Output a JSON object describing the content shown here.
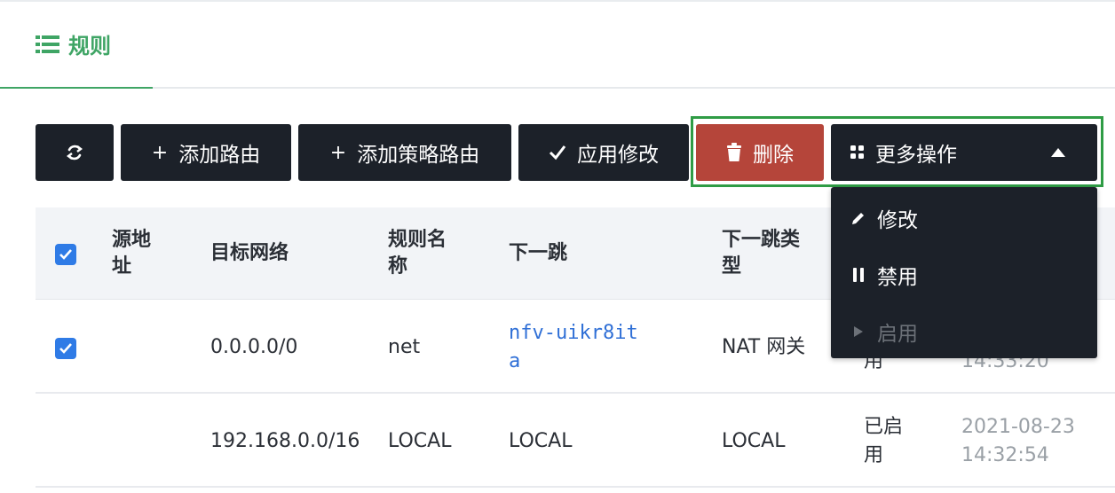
{
  "header": {
    "title": "规则",
    "icon": "list-icon"
  },
  "toolbar": {
    "refresh_icon": "refresh-icon",
    "add_route": "添加路由",
    "add_policy_route": "添加策略路由",
    "apply_changes": "应用修改",
    "delete": "删除",
    "more_actions": "更多操作"
  },
  "dropdown": {
    "items": [
      {
        "label": "修改",
        "icon": "pencil-icon",
        "disabled": false
      },
      {
        "label": "禁用",
        "icon": "pause-icon",
        "disabled": false
      },
      {
        "label": "启用",
        "icon": "play-icon",
        "disabled": true
      }
    ]
  },
  "table": {
    "headers": {
      "source_line1": "源地",
      "source_line2": "址",
      "dest_network": "目标网络",
      "rule_name_line1": "规则名",
      "rule_name_line2": "称",
      "next_hop": "下一跳",
      "next_hop_type_line1": "下一跳类",
      "next_hop_type_line2": "型"
    },
    "rows": [
      {
        "checked": true,
        "source": "",
        "dest_network": "0.0.0.0/0",
        "rule_name": "net",
        "next_hop_line1": "nfv-uikr8it",
        "next_hop_line2": "a",
        "next_hop_type": "NAT 网关",
        "status_partial": "用",
        "time_partial": "14:33:20"
      },
      {
        "checked": false,
        "source": "",
        "dest_network": "192.168.0.0/16",
        "rule_name": "LOCAL",
        "next_hop": "LOCAL",
        "next_hop_type": "LOCAL",
        "status_line1": "已启",
        "status_line2": "用",
        "time_line1": "2021-08-23",
        "time_line2": "14:32:54"
      }
    ]
  },
  "colors": {
    "accent_green": "#3fa565",
    "button_dark": "#1c2129",
    "delete_red": "#b5453a",
    "link_blue": "#2f6fd6",
    "checkbox_blue": "#2f7be6",
    "highlight_green": "#2f9c45"
  }
}
